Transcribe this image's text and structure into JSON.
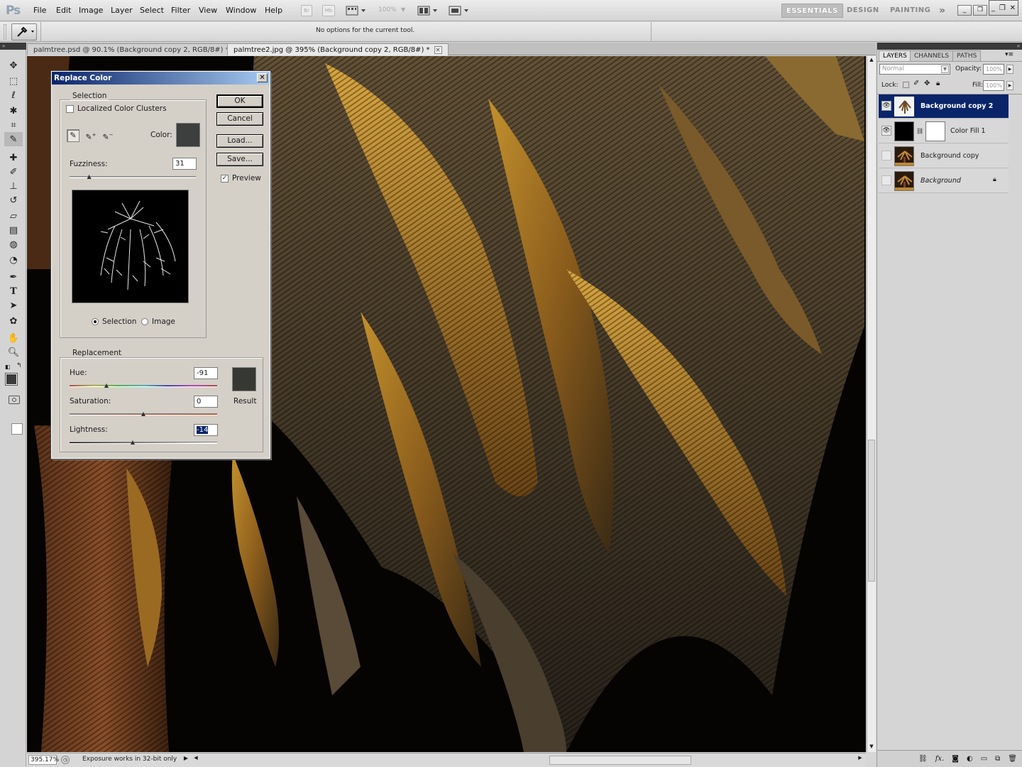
{
  "app": {
    "logo": "Ps"
  },
  "menu": {
    "items": [
      "File",
      "Edit",
      "Image",
      "Layer",
      "Select",
      "Filter",
      "View",
      "Window",
      "Help"
    ]
  },
  "menubar_controls": {
    "bridge": "Br",
    "minibridge": "Mb",
    "zoom": "100%"
  },
  "workspaces": {
    "essentials": "ESSENTIALS",
    "design": "DESIGN",
    "painting": "PAINTING",
    "more": "»"
  },
  "options": {
    "message": "No options for the current tool."
  },
  "tabs": [
    {
      "label": "palmtree.psd @ 90.1% (Background copy 2, RGB/8#) *"
    },
    {
      "label": "palmtree2.jpg @ 395% (Background copy 2, RGB/8#) *"
    }
  ],
  "status": {
    "zoom": "395.17%",
    "text": "Exposure works in 32-bit only"
  },
  "dialog": {
    "title": "Replace Color",
    "selection_group": "Selection",
    "localized_label": "Localized Color Clusters",
    "color_label": "Color:",
    "fuzziness_label": "Fuzziness:",
    "fuzziness_value": "31",
    "fuzziness_fraction": 0.155,
    "radio_selection": "Selection",
    "radio_image": "Image",
    "replacement_group": "Replacement",
    "hue_label": "Hue:",
    "hue_value": "-91",
    "saturation_label": "Saturation:",
    "saturation_value": "0",
    "lightness_label": "Lightness:",
    "lightness_value": "-14",
    "result_label": "Result",
    "ok": "OK",
    "cancel": "Cancel",
    "load": "Load...",
    "save": "Save...",
    "preview": "Preview",
    "selected_color": "#3c3f3e",
    "result_color": "#363833"
  },
  "layers_panel": {
    "tabs": [
      "LAYERS",
      "CHANNELS",
      "PATHS"
    ],
    "blend_mode": "Normal",
    "opacity_label": "Opacity:",
    "opacity_value": "100%",
    "lock_label": "Lock:",
    "fill_label": "Fill:",
    "fill_value": "100%",
    "layers": [
      {
        "name": "Background copy 2"
      },
      {
        "name": "Color Fill 1"
      },
      {
        "name": "Background copy"
      },
      {
        "name": "Background"
      }
    ]
  }
}
